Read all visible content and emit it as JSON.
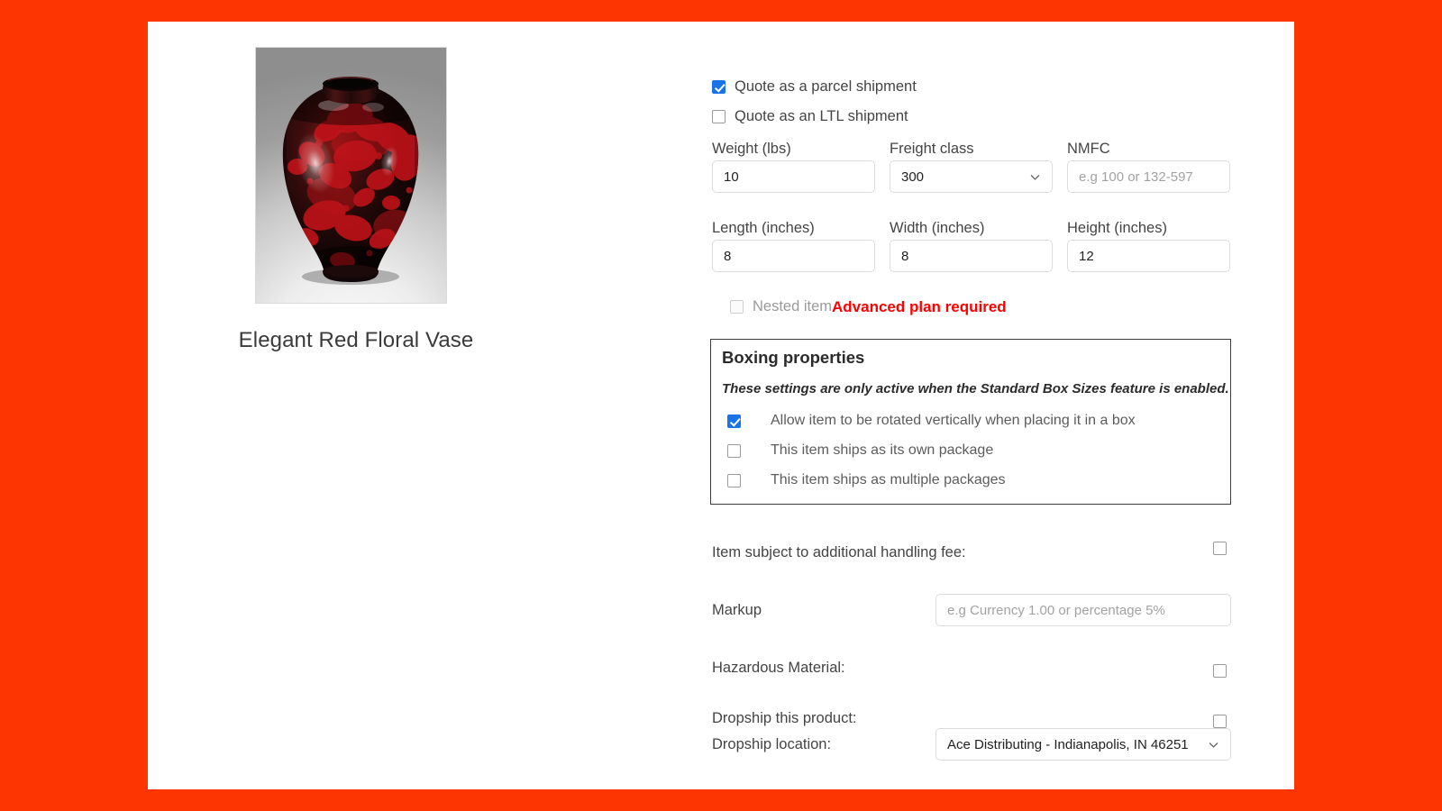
{
  "theme": {
    "page_background": "#fc3503",
    "panel_background": "#ffffff",
    "accent_checkbox": "#1a73e8",
    "warning_color": "#ff0000"
  },
  "product": {
    "title": "Elegant Red Floral Vase",
    "image_alt": "vase-photo"
  },
  "shipping_mode": {
    "parcel": {
      "label": "Quote as a parcel shipment",
      "checked": true
    },
    "ltl": {
      "label": "Quote as an LTL shipment",
      "checked": false
    }
  },
  "fields": {
    "weight": {
      "label": "Weight (lbs)",
      "value": "10"
    },
    "freight_class": {
      "label": "Freight class",
      "value": "300",
      "options": [
        "300"
      ]
    },
    "nmfc": {
      "label": "NMFC",
      "value": "",
      "placeholder": "e.g 100 or 132-597"
    },
    "length": {
      "label": "Length (inches)",
      "value": "8"
    },
    "width": {
      "label": "Width (inches)",
      "value": "8"
    },
    "height": {
      "label": "Height (inches)",
      "value": "12"
    }
  },
  "nested_item": {
    "label": "Nested item",
    "checked": false,
    "disabled": true,
    "warning": "Advanced plan required"
  },
  "boxing": {
    "title": "Boxing properties",
    "note": "These settings are only active when the Standard Box Sizes feature is enabled.",
    "options": [
      {
        "label": "Allow item to be rotated vertically when placing it in a box",
        "checked": true
      },
      {
        "label": "This item ships as its own package",
        "checked": false
      },
      {
        "label": "This item ships as multiple packages",
        "checked": false
      }
    ]
  },
  "extras": {
    "handling_fee": {
      "label": "Item subject to additional handling fee:",
      "checked": false
    },
    "markup": {
      "label": "Markup",
      "value": "",
      "placeholder": "e.g Currency 1.00 or percentage 5%"
    },
    "hazardous": {
      "label": "Hazardous Material:",
      "checked": false
    },
    "dropship_product": {
      "label": "Dropship this product:",
      "checked": false
    },
    "dropship_location": {
      "label": "Dropship location:",
      "value": "Ace Distributing - Indianapolis, IN 46251",
      "options": [
        "Ace Distributing - Indianapolis, IN 46251"
      ]
    }
  },
  "icons": {
    "chevron_down": "chevron-down-icon",
    "checkmark": "checkmark-icon"
  }
}
